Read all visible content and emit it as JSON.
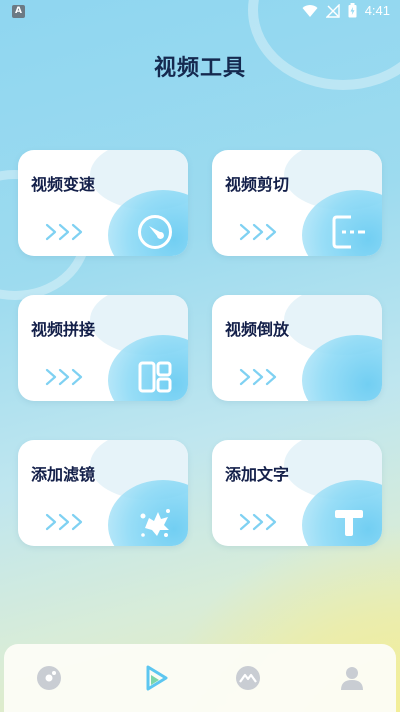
{
  "status_bar": {
    "time": "4:41",
    "left_badge": "A",
    "icons": [
      "wifi-icon",
      "signal-off-icon",
      "battery-icon"
    ]
  },
  "page": {
    "title": "视频工具"
  },
  "cards": [
    {
      "label": "视频变速",
      "icon": "speed-dial-icon"
    },
    {
      "label": "视频剪切",
      "icon": "cut-icon"
    },
    {
      "label": "视频拼接",
      "icon": "grid-splice-icon"
    },
    {
      "label": "视频倒放",
      "icon": "reverse-icon"
    },
    {
      "label": "添加滤镜",
      "icon": "filter-splash-icon"
    },
    {
      "label": "添加文字",
      "icon": "text-t-icon"
    }
  ],
  "bottom_nav": {
    "tabs": [
      {
        "name": "home",
        "icon": "disc-icon",
        "active": false
      },
      {
        "name": "tools",
        "icon": "play-icon",
        "active": true
      },
      {
        "name": "explore",
        "icon": "mountain-icon",
        "active": false
      },
      {
        "name": "profile",
        "icon": "user-icon",
        "active": false
      }
    ]
  },
  "colors": {
    "title": "#15294f",
    "accent_blue": "#62c9f1",
    "play_green": "#7bd6a8",
    "inactive_icon": "#c9cdd3"
  }
}
